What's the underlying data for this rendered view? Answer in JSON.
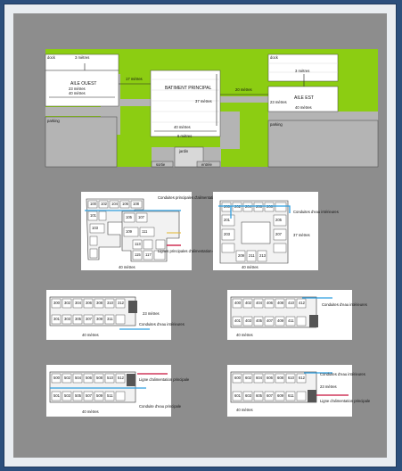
{
  "site_plan": {
    "labels": {
      "dock_left": "dock",
      "dock_right": "dock",
      "aile_ouest": "AILE OUEST",
      "aile_est": "AILE EST",
      "batiment": "BATIMENT PRINCIPAL",
      "parking_left": "parking",
      "parking_right": "parking",
      "jardin": "jardin",
      "sortie": "sortie",
      "entree": "entrée"
    },
    "dimensions": {
      "w_top": "3 mètres",
      "w_width": "23 mètres",
      "w_length": "40 mètres",
      "gap_left": "17 mètres",
      "main_height": "37 mètres",
      "gap_right": "20 mètres",
      "main_width": "40 mètres",
      "garden": "6 mètres",
      "e_top": "3 mètres",
      "e_width": "23 mètres",
      "e_length": "40 mètres"
    }
  },
  "floor_plans": [
    {
      "rooms": [
        "100",
        "102",
        "104",
        "106",
        "108",
        "110",
        "112",
        "101",
        "103",
        "105",
        "107",
        "109",
        "111",
        "113",
        "115",
        "117",
        "119",
        "121",
        "123",
        "125",
        "127",
        "129",
        "131",
        "133",
        "135"
      ],
      "legend": {
        "water_main": "Conduites principales d'alimentation en eau",
        "power_line": "Lignes principales d'alimentation en électricité"
      },
      "dimension": "40 mètres"
    },
    {
      "rooms": [
        "200",
        "202",
        "204",
        "206",
        "208",
        "210",
        "212",
        "201",
        "203",
        "205",
        "207",
        "209",
        "211",
        "213",
        "215",
        "217",
        "219",
        "221",
        "223",
        "225",
        "227",
        "229"
      ],
      "legend": {
        "water_pipes": "Conduites d'eau intérieures",
        "height": "37 mètres"
      },
      "dimension": "40 mètres"
    },
    {
      "rooms": [
        "300",
        "302",
        "304",
        "306",
        "308",
        "310",
        "312",
        "314",
        "301",
        "303",
        "305",
        "307",
        "309",
        "311",
        "313",
        "315"
      ],
      "legend": {
        "height": "23 mètres",
        "water_pipes": "Conduites d'eau intérieures"
      },
      "dimension": "40 mètres"
    },
    {
      "rooms": [
        "400",
        "402",
        "404",
        "406",
        "408",
        "410",
        "412",
        "414",
        "401",
        "403",
        "405",
        "407",
        "409",
        "411",
        "413",
        "415"
      ],
      "legend": {
        "water_pipes": "Conduites d'eau intérieures"
      },
      "dimension": "40 mètres"
    },
    {
      "rooms": [
        "500",
        "502",
        "504",
        "506",
        "508",
        "510",
        "512",
        "514",
        "501",
        "503",
        "505",
        "507",
        "509",
        "511",
        "513",
        "515"
      ],
      "legend": {
        "power_line": "Ligne d'alimentation principale",
        "water_main": "Conduite d'eau principale"
      },
      "dimension": "40 mètres"
    },
    {
      "rooms": [
        "600",
        "602",
        "604",
        "606",
        "608",
        "610",
        "612",
        "614",
        "601",
        "603",
        "605",
        "607",
        "609",
        "611",
        "613",
        "615"
      ],
      "legend": {
        "water_pipes": "Conduites d'eau intérieures",
        "height": "23 mètres",
        "power_line": "Ligne d'alimentation principale"
      },
      "dimension": "40 mètres"
    }
  ],
  "colors": {
    "border": "#2c4f7c",
    "panel": "#8d8d8d",
    "grass": "#8ccd12",
    "water": "#2f9fe0",
    "power": "#c8103a"
  }
}
